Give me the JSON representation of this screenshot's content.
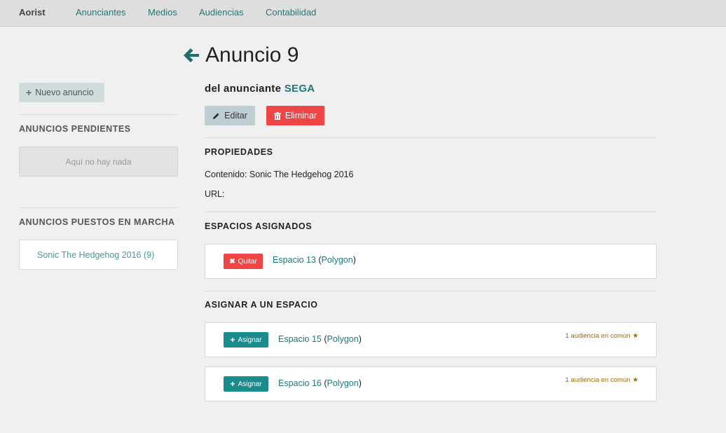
{
  "nav": {
    "brand": "Aorist",
    "links": [
      "Anunciantes",
      "Medios",
      "Audiencias",
      "Contabilidad"
    ]
  },
  "sidebar": {
    "new_button": "Nuevo anuncio",
    "pending_heading": "ANUNCIOS PENDIENTES",
    "pending_empty": "Aquí no hay nada",
    "running_heading": "ANUNCIOS PUESTOS EN MARCHA",
    "running_items": [
      "Sonic The Hedgehog 2016 (9)"
    ]
  },
  "main": {
    "title": "Anuncio 9",
    "subtitle_prefix": "del anunciante",
    "advertiser": "SEGA",
    "edit_label": "Editar",
    "delete_label": "Eliminar",
    "properties_heading": "PROPIEDADES",
    "content_line": "Contenido: Sonic The Hedgehog 2016",
    "url_line": "URL:",
    "assigned_heading": "ESPACIOS ASIGNADOS",
    "assigned": [
      {
        "button": "Quitar",
        "space": "Espacio 13",
        "medium": "Polygon"
      }
    ],
    "assign_heading": "ASIGNAR A UN ESPACIO",
    "available": [
      {
        "button": "Asignar",
        "space": "Espacio 15",
        "medium": "Polygon",
        "common": "1 audiencia en común"
      },
      {
        "button": "Asignar",
        "space": "Espacio 16",
        "medium": "Polygon",
        "common": "1 audiencia en común"
      }
    ]
  },
  "colors": {
    "accent": "#1f7a7a",
    "danger": "#f04545",
    "assign": "#1a8c8c",
    "common": "#a06a00"
  }
}
